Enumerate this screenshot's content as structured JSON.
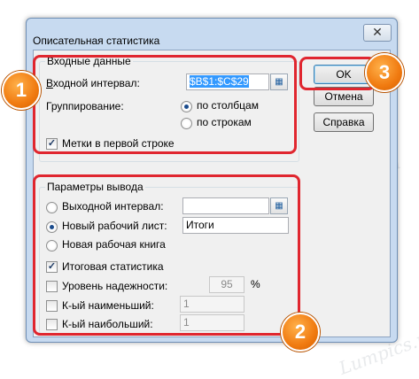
{
  "dialog": {
    "title": "Описательная статистика",
    "close_glyph": "✕"
  },
  "input_group": {
    "label": "Входные данные",
    "range_label": "Входной интервал:",
    "range_value": "$B$1:$C$29",
    "grouping_label": "Группирование:",
    "by_columns": "по столбцам",
    "by_rows": "по строкам",
    "labels_first_row": "Метки в первой строке"
  },
  "output_group": {
    "label": "Параметры вывода",
    "output_range": "Выходной интервал:",
    "output_range_value": "",
    "new_sheet": "Новый рабочий лист:",
    "new_sheet_value": "Итоги",
    "new_workbook": "Новая рабочая книга",
    "summary_stats": "Итоговая статистика",
    "confidence_level": "Уровень надежности:",
    "confidence_value": "95",
    "percent_sign": "%",
    "kth_smallest": "К-ый наименьший:",
    "kth_smallest_value": "1",
    "kth_largest": "К-ый наибольший:",
    "kth_largest_value": "1"
  },
  "buttons": {
    "ok": "OK",
    "cancel": "Отмена",
    "help": "Справка"
  },
  "annotations": {
    "badge_1": "1",
    "badge_2": "2",
    "badge_3": "3",
    "highlight_color": "#e0262f",
    "badge_color": "#f07a10"
  },
  "watermark": {
    "text": "Lumpics.ru"
  }
}
